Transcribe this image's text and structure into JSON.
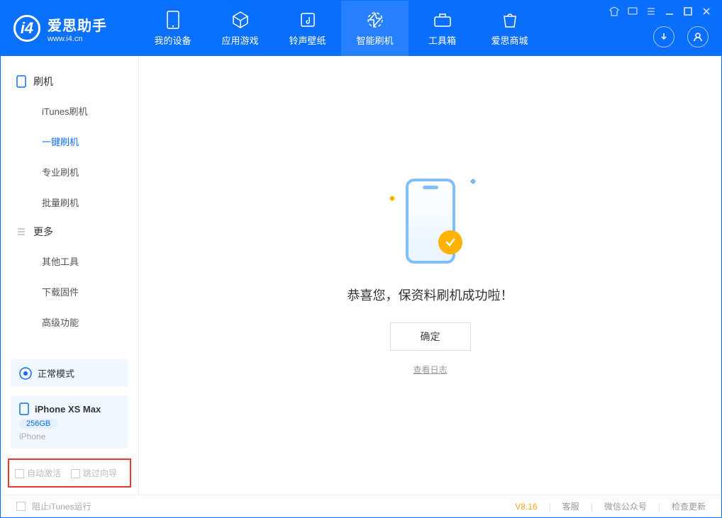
{
  "app": {
    "name_cn": "爱思助手",
    "name_en": "www.i4.cn"
  },
  "nav": {
    "items": [
      {
        "label": "我的设备"
      },
      {
        "label": "应用游戏"
      },
      {
        "label": "铃声壁纸"
      },
      {
        "label": "智能刷机"
      },
      {
        "label": "工具箱"
      },
      {
        "label": "爱思商城"
      }
    ]
  },
  "sidebar": {
    "section1": "刷机",
    "items1": [
      {
        "label": "iTunes刷机"
      },
      {
        "label": "一键刷机"
      },
      {
        "label": "专业刷机"
      },
      {
        "label": "批量刷机"
      }
    ],
    "section2": "更多",
    "items2": [
      {
        "label": "其他工具"
      },
      {
        "label": "下载固件"
      },
      {
        "label": "高级功能"
      }
    ]
  },
  "mode": {
    "label": "正常模式"
  },
  "device": {
    "name": "iPhone XS Max",
    "capacity": "256GB",
    "type": "iPhone"
  },
  "options": {
    "auto_activate": "自动激活",
    "skip_guide": "跳过向导"
  },
  "result": {
    "message": "恭喜您，保资料刷机成功啦！",
    "ok": "确定",
    "view_log": "查看日志"
  },
  "footer": {
    "block_itunes": "阻止iTunes运行",
    "version": "V8.16",
    "support": "客服",
    "wechat": "微信公众号",
    "check_update": "检查更新"
  }
}
